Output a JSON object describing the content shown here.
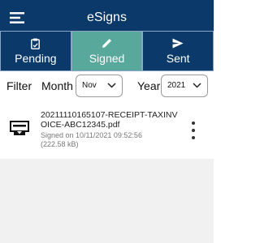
{
  "app": {
    "title": "eSigns"
  },
  "tabs": [
    {
      "label": "Pending",
      "icon": "clipboard-icon"
    },
    {
      "label": "Signed",
      "icon": "pencil-icon"
    },
    {
      "label": "Sent",
      "icon": "send-icon"
    }
  ],
  "filter": {
    "label": "Filter",
    "month_label": "Month",
    "month_value": "Nov",
    "year_label": "Year",
    "year_value": "2021"
  },
  "documents": [
    {
      "name": "20211110165107-RECEIPT-TAXINVOICE-ABC12345.pdf",
      "signed_on": "Signed on 10/11/2021 09:52:56",
      "size": "(222.58 kB)",
      "icon": "document-sign-icon"
    }
  ],
  "colors": {
    "primary": "#0b3a6a",
    "active_tab": "#58a89c",
    "list_background": "#f1f1f1"
  }
}
